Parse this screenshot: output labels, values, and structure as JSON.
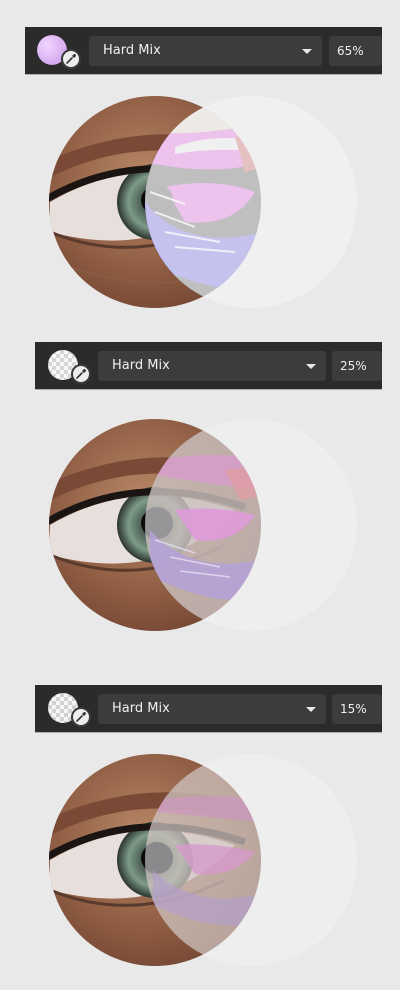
{
  "panels": [
    {
      "blend_mode": "Hard Mix",
      "opacity": "65%",
      "swatch_color": "#d8a8f0",
      "swatch_icon": "color-swatch-lilac",
      "picker_icon": "eyedropper-icon"
    },
    {
      "blend_mode": "Hard Mix",
      "opacity": "25%",
      "swatch_color": "#ffffff",
      "swatch_icon": "transparent-checker-swatch",
      "picker_icon": "eyedropper-icon"
    },
    {
      "blend_mode": "Hard Mix",
      "opacity": "15%",
      "swatch_color": "#ffffff",
      "swatch_icon": "transparent-checker-swatch",
      "picker_icon": "eyedropper-icon"
    }
  ],
  "colors": {
    "toolbar_bg": "#2b2b2b",
    "field_bg": "#3c3c3c",
    "page_bg": "#e9e9e9",
    "hard_mix_magenta": "#d81ad6",
    "hard_mix_blue": "#2a1ae0",
    "overlay_white": "#f2f2f2"
  }
}
